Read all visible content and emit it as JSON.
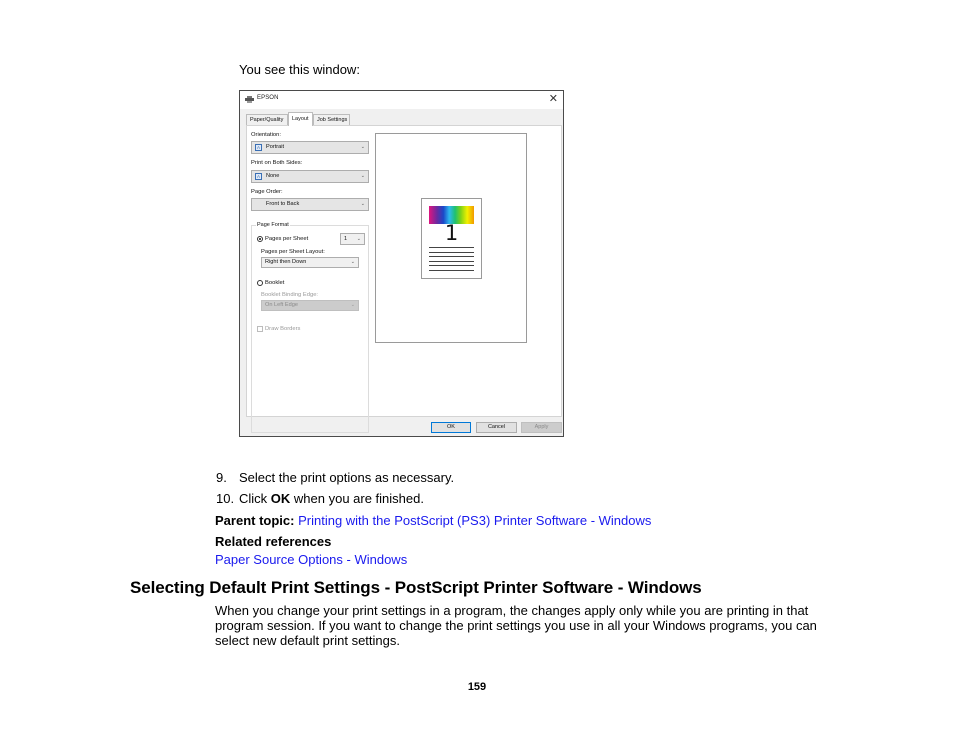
{
  "intro": "You see this window:",
  "dialog": {
    "title": "EPSON",
    "close_glyph": "✕",
    "tabs": [
      {
        "label": "Paper/Quality",
        "active": false
      },
      {
        "label": "Layout",
        "active": true
      },
      {
        "label": "Job Settings",
        "active": false
      }
    ],
    "orientation": {
      "label": "Orientation:",
      "value": "Portrait"
    },
    "print_both_sides": {
      "label": "Print on Both Sides:",
      "value": "None"
    },
    "page_order": {
      "label": "Page Order:",
      "value": "Front to Back"
    },
    "page_format": {
      "title": "Page Format",
      "pages_per_sheet": {
        "label": "Pages per Sheet",
        "value": "1",
        "selected": true
      },
      "layout": {
        "label": "Pages per Sheet Layout:",
        "value": "Right then Down"
      },
      "booklet": {
        "label": "Booklet",
        "selected": false
      },
      "binding_edge": {
        "label": "Booklet Binding Edge:",
        "value": "On Left Edge",
        "disabled": true
      },
      "draw_borders": {
        "label": "Draw Borders",
        "checked": false,
        "disabled": true
      }
    },
    "preview": {
      "page_number": "1"
    },
    "buttons": {
      "ok": "OK",
      "cancel": "Cancel",
      "apply": "Apply"
    },
    "chevron_glyph": "⌄",
    "icon_glyph": "A"
  },
  "steps": [
    {
      "number": "9.",
      "text": "Select the print options as necessary."
    },
    {
      "number": "10.",
      "prefix": "Click ",
      "bold": "OK",
      "suffix": " when you are finished."
    }
  ],
  "parent_topic": {
    "label": "Parent topic:",
    "link": "Printing with the PostScript (PS3) Printer Software - Windows"
  },
  "related": {
    "label": "Related references",
    "links": [
      "Paper Source Options - Windows"
    ]
  },
  "section": {
    "heading": "Selecting Default Print Settings - PostScript Printer Software - Windows",
    "paragraph": "When you change your print settings in a program, the changes apply only while you are printing in that program session. If you want to change the print settings you use in all your Windows programs, you can select new default print settings."
  },
  "page_number": "159"
}
